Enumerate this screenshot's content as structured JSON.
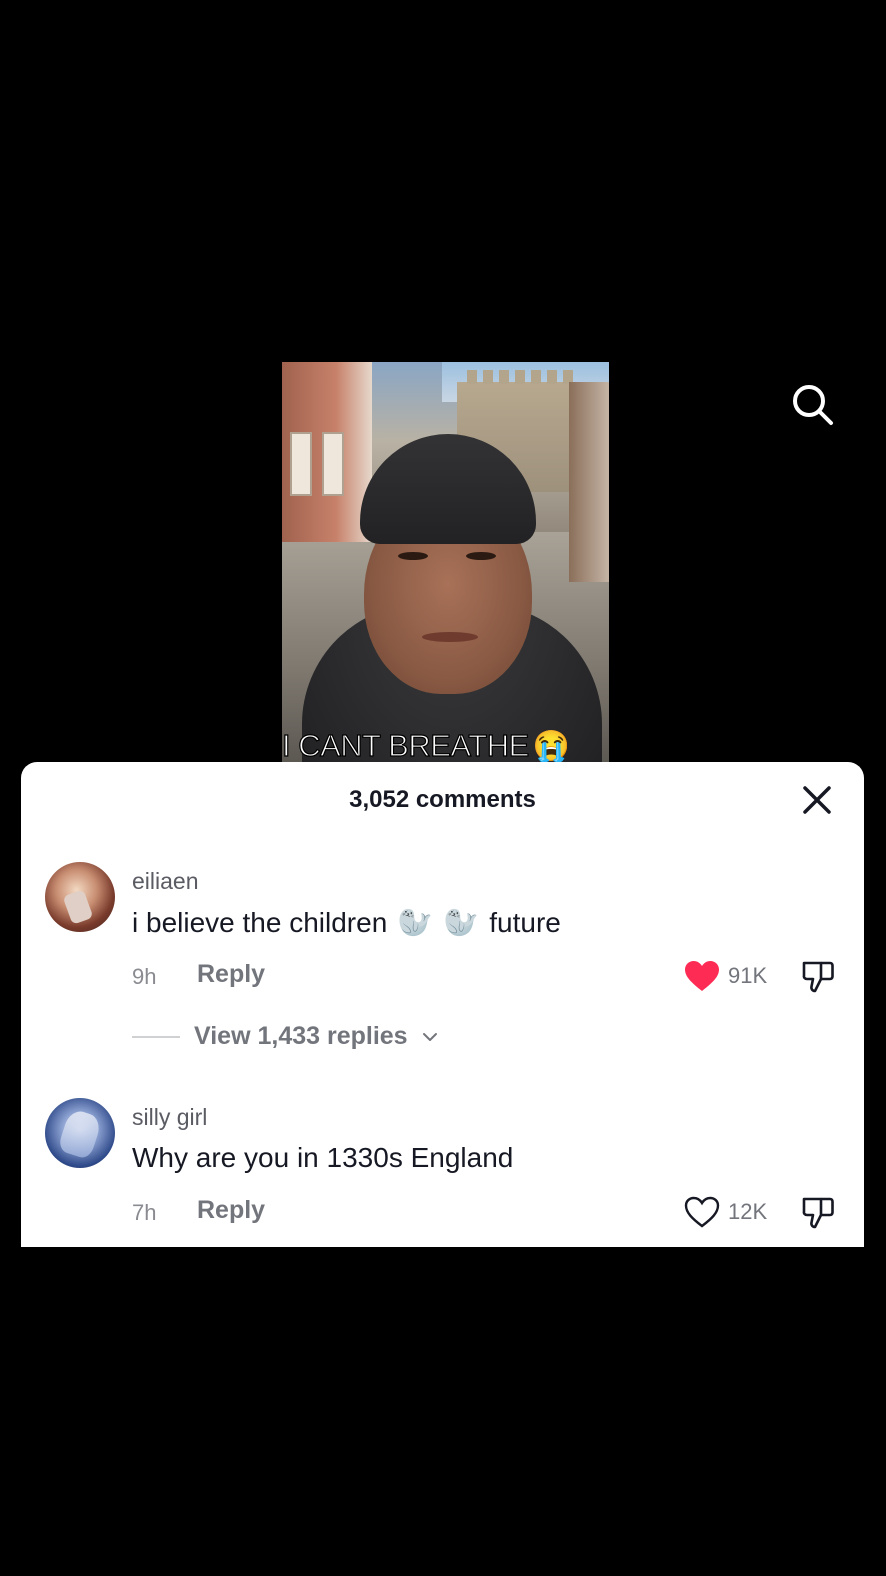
{
  "video": {
    "caption": "I CANT BREATHE",
    "caption_emoji": "😭"
  },
  "comments_panel": {
    "title": "3,052 comments",
    "comments": [
      {
        "username": "eiliaen",
        "text_before": "i believe the children",
        "emoji": "🦭",
        "text_after": "future",
        "time": "9h",
        "reply_label": "Reply",
        "likes": "91K",
        "liked": true,
        "view_replies": "View 1,433 replies"
      },
      {
        "username": "silly girl",
        "text": "Why are you in 1330s England",
        "time": "7h",
        "reply_label": "Reply",
        "likes": "12K",
        "liked": false
      }
    ]
  },
  "colors": {
    "like_active": "#fe2c55",
    "text_primary": "#161823",
    "text_secondary": "#73757c"
  },
  "icons": [
    "search-icon",
    "close-icon",
    "heart-filled-icon",
    "heart-outline-icon",
    "dislike-icon",
    "chevron-down-icon"
  ]
}
